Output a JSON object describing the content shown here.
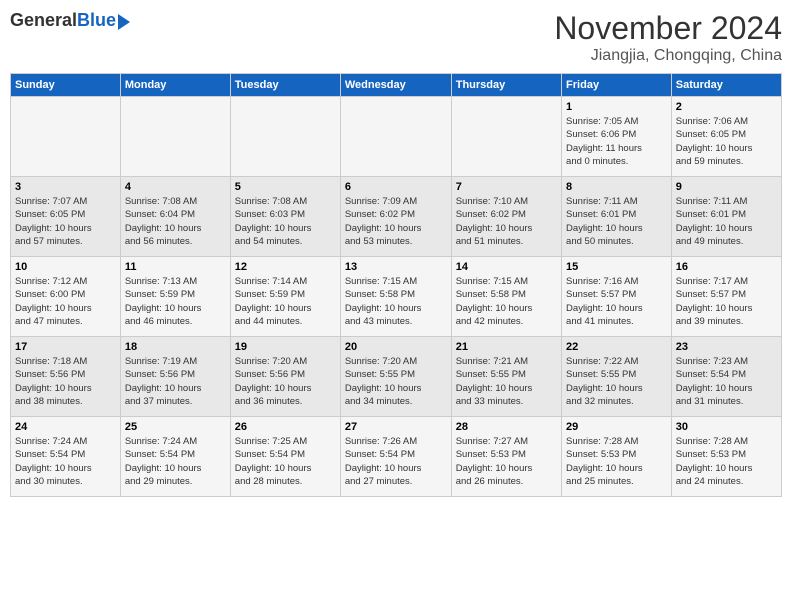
{
  "header": {
    "logo_general": "General",
    "logo_blue": "Blue",
    "month_title": "November 2024",
    "location": "Jiangjia, Chongqing, China"
  },
  "columns": [
    "Sunday",
    "Monday",
    "Tuesday",
    "Wednesday",
    "Thursday",
    "Friday",
    "Saturday"
  ],
  "weeks": [
    {
      "days": [
        {
          "num": "",
          "info": ""
        },
        {
          "num": "",
          "info": ""
        },
        {
          "num": "",
          "info": ""
        },
        {
          "num": "",
          "info": ""
        },
        {
          "num": "",
          "info": ""
        },
        {
          "num": "1",
          "info": "Sunrise: 7:05 AM\nSunset: 6:06 PM\nDaylight: 11 hours\nand 0 minutes."
        },
        {
          "num": "2",
          "info": "Sunrise: 7:06 AM\nSunset: 6:05 PM\nDaylight: 10 hours\nand 59 minutes."
        }
      ]
    },
    {
      "days": [
        {
          "num": "3",
          "info": "Sunrise: 7:07 AM\nSunset: 6:05 PM\nDaylight: 10 hours\nand 57 minutes."
        },
        {
          "num": "4",
          "info": "Sunrise: 7:08 AM\nSunset: 6:04 PM\nDaylight: 10 hours\nand 56 minutes."
        },
        {
          "num": "5",
          "info": "Sunrise: 7:08 AM\nSunset: 6:03 PM\nDaylight: 10 hours\nand 54 minutes."
        },
        {
          "num": "6",
          "info": "Sunrise: 7:09 AM\nSunset: 6:02 PM\nDaylight: 10 hours\nand 53 minutes."
        },
        {
          "num": "7",
          "info": "Sunrise: 7:10 AM\nSunset: 6:02 PM\nDaylight: 10 hours\nand 51 minutes."
        },
        {
          "num": "8",
          "info": "Sunrise: 7:11 AM\nSunset: 6:01 PM\nDaylight: 10 hours\nand 50 minutes."
        },
        {
          "num": "9",
          "info": "Sunrise: 7:11 AM\nSunset: 6:01 PM\nDaylight: 10 hours\nand 49 minutes."
        }
      ]
    },
    {
      "days": [
        {
          "num": "10",
          "info": "Sunrise: 7:12 AM\nSunset: 6:00 PM\nDaylight: 10 hours\nand 47 minutes."
        },
        {
          "num": "11",
          "info": "Sunrise: 7:13 AM\nSunset: 5:59 PM\nDaylight: 10 hours\nand 46 minutes."
        },
        {
          "num": "12",
          "info": "Sunrise: 7:14 AM\nSunset: 5:59 PM\nDaylight: 10 hours\nand 44 minutes."
        },
        {
          "num": "13",
          "info": "Sunrise: 7:15 AM\nSunset: 5:58 PM\nDaylight: 10 hours\nand 43 minutes."
        },
        {
          "num": "14",
          "info": "Sunrise: 7:15 AM\nSunset: 5:58 PM\nDaylight: 10 hours\nand 42 minutes."
        },
        {
          "num": "15",
          "info": "Sunrise: 7:16 AM\nSunset: 5:57 PM\nDaylight: 10 hours\nand 41 minutes."
        },
        {
          "num": "16",
          "info": "Sunrise: 7:17 AM\nSunset: 5:57 PM\nDaylight: 10 hours\nand 39 minutes."
        }
      ]
    },
    {
      "days": [
        {
          "num": "17",
          "info": "Sunrise: 7:18 AM\nSunset: 5:56 PM\nDaylight: 10 hours\nand 38 minutes."
        },
        {
          "num": "18",
          "info": "Sunrise: 7:19 AM\nSunset: 5:56 PM\nDaylight: 10 hours\nand 37 minutes."
        },
        {
          "num": "19",
          "info": "Sunrise: 7:20 AM\nSunset: 5:56 PM\nDaylight: 10 hours\nand 36 minutes."
        },
        {
          "num": "20",
          "info": "Sunrise: 7:20 AM\nSunset: 5:55 PM\nDaylight: 10 hours\nand 34 minutes."
        },
        {
          "num": "21",
          "info": "Sunrise: 7:21 AM\nSunset: 5:55 PM\nDaylight: 10 hours\nand 33 minutes."
        },
        {
          "num": "22",
          "info": "Sunrise: 7:22 AM\nSunset: 5:55 PM\nDaylight: 10 hours\nand 32 minutes."
        },
        {
          "num": "23",
          "info": "Sunrise: 7:23 AM\nSunset: 5:54 PM\nDaylight: 10 hours\nand 31 minutes."
        }
      ]
    },
    {
      "days": [
        {
          "num": "24",
          "info": "Sunrise: 7:24 AM\nSunset: 5:54 PM\nDaylight: 10 hours\nand 30 minutes."
        },
        {
          "num": "25",
          "info": "Sunrise: 7:24 AM\nSunset: 5:54 PM\nDaylight: 10 hours\nand 29 minutes."
        },
        {
          "num": "26",
          "info": "Sunrise: 7:25 AM\nSunset: 5:54 PM\nDaylight: 10 hours\nand 28 minutes."
        },
        {
          "num": "27",
          "info": "Sunrise: 7:26 AM\nSunset: 5:54 PM\nDaylight: 10 hours\nand 27 minutes."
        },
        {
          "num": "28",
          "info": "Sunrise: 7:27 AM\nSunset: 5:53 PM\nDaylight: 10 hours\nand 26 minutes."
        },
        {
          "num": "29",
          "info": "Sunrise: 7:28 AM\nSunset: 5:53 PM\nDaylight: 10 hours\nand 25 minutes."
        },
        {
          "num": "30",
          "info": "Sunrise: 7:28 AM\nSunset: 5:53 PM\nDaylight: 10 hours\nand 24 minutes."
        }
      ]
    }
  ]
}
